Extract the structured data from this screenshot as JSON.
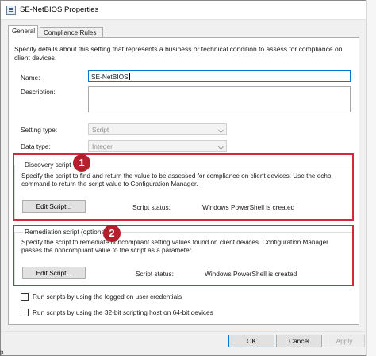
{
  "window": {
    "title": "SE-NetBIOS Properties"
  },
  "tabs": [
    {
      "label": "General",
      "active": true
    },
    {
      "label": "Compliance Rules",
      "active": false
    }
  ],
  "intro": "Specify details about this setting that represents a business or technical condition to assess for compliance on client devices.",
  "fields": {
    "name_label": "Name:",
    "name_value": "SE-NetBIOS",
    "description_label": "Description:",
    "description_value": "",
    "setting_type_label": "Setting type:",
    "setting_type_value": "Script",
    "data_type_label": "Data type:",
    "data_type_value": "Integer"
  },
  "discovery": {
    "title": "Discovery script",
    "description": "Specify the script to find and return the value to be assessed for compliance on client devices. Use the echo command to return the script value to Configuration Manager.",
    "edit_label": "Edit Script...",
    "status_label": "Script status:",
    "status_value": "Windows PowerShell is created",
    "badge": "1"
  },
  "remediation": {
    "title": "Remediation script (optional)",
    "description": "Specify the script to remediate noncompliant setting values found on client devices. Configuration Manager passes the noncompliant value to the script as a parameter.",
    "edit_label": "Edit Script...",
    "status_label": "Script status:",
    "status_value": "Windows PowerShell is created",
    "badge": "2"
  },
  "options": [
    {
      "label": "Run scripts by using the logged on user credentials",
      "checked": false
    },
    {
      "label": "Run scripts by using the 32-bit scripting host on 64-bit devices",
      "checked": false
    }
  ],
  "buttons": {
    "ok": "OK",
    "cancel": "Cancel",
    "apply": "Apply"
  },
  "edge_fragment": "p.",
  "colors": {
    "highlight": "#d7263d",
    "badge": "#b51e2d",
    "focus": "#0078d7"
  },
  "icons": {
    "app": "properties-window-icon",
    "dropdown": "chevron-down-icon"
  }
}
